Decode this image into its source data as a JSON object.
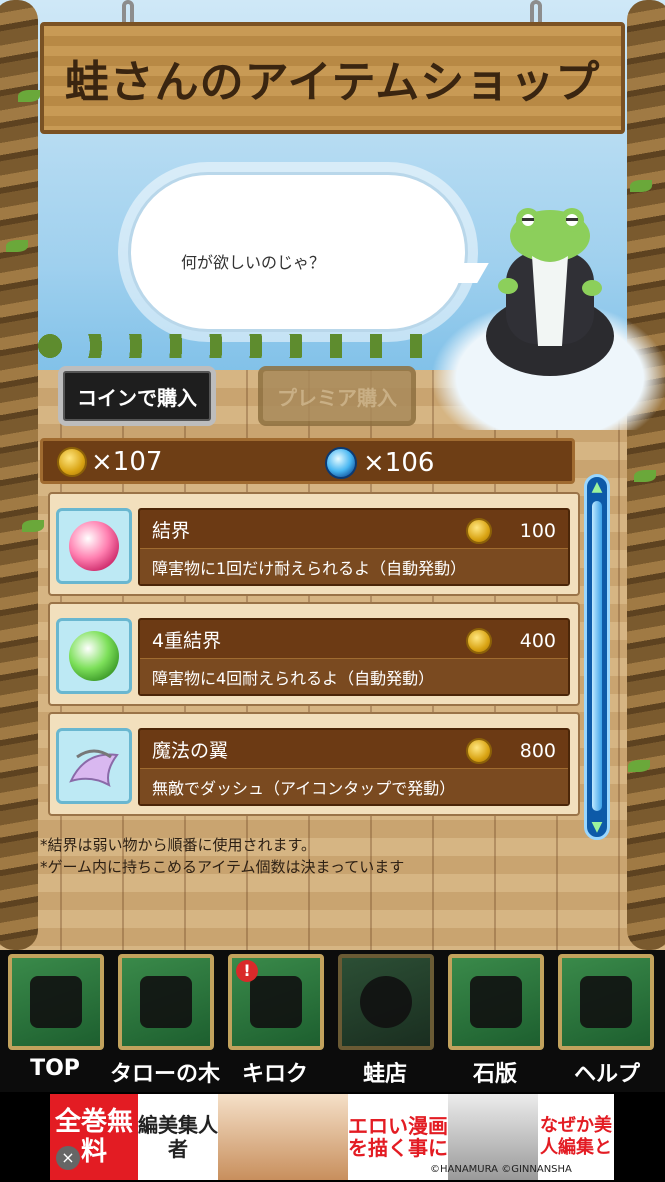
{
  "sign": {
    "title": "蛙さんのアイテムショップ"
  },
  "dialog": {
    "text": "何が欲しいのじゃ？"
  },
  "modes": {
    "coin_label": "コインで購入",
    "premium_label": "プレミア購入"
  },
  "currency": {
    "coins": "×107",
    "gems": "×106"
  },
  "items": [
    {
      "name": "結界",
      "price": "100",
      "description": "障害物に1回だけ耐えられるよ（自動発動）",
      "icon": "pink-orb-icon"
    },
    {
      "name": "4重結界",
      "price": "400",
      "description": "障害物に4回耐えられるよ（自動発動）",
      "icon": "green-orb-icon"
    },
    {
      "name": "魔法の翼",
      "price": "800",
      "description": "無敵でダッシュ（アイコンタップで発動）",
      "icon": "wing-tiara-icon"
    }
  ],
  "notes": [
    "*結界は弱い物から順番に使用されます。",
    "*ゲーム内に持ちこめるアイテム個数は決まっています"
  ],
  "nav": [
    {
      "label": "TOP",
      "icon": "running-figure-icon"
    },
    {
      "label": "タローの木",
      "icon": "sprout-icon"
    },
    {
      "label": "キロク",
      "icon": "scroll-icon"
    },
    {
      "label": "蛙店",
      "icon": "frog-coin-icon"
    },
    {
      "label": "石版",
      "icon": "stone-tablet-icon"
    },
    {
      "label": "ヘルプ",
      "icon": "question-mark-icon"
    }
  ],
  "ad": {
    "left": "全巻無料",
    "mid1": "編美集人者",
    "mid2": "エロい漫画を描く事に",
    "right": "なぜか美人編集と",
    "credit": "©HANAMURA ©GINNANSHA"
  },
  "colors": {
    "accent": "#6c3a14",
    "nav_border": "#c2a25d",
    "ad_red": "#e31c23"
  }
}
